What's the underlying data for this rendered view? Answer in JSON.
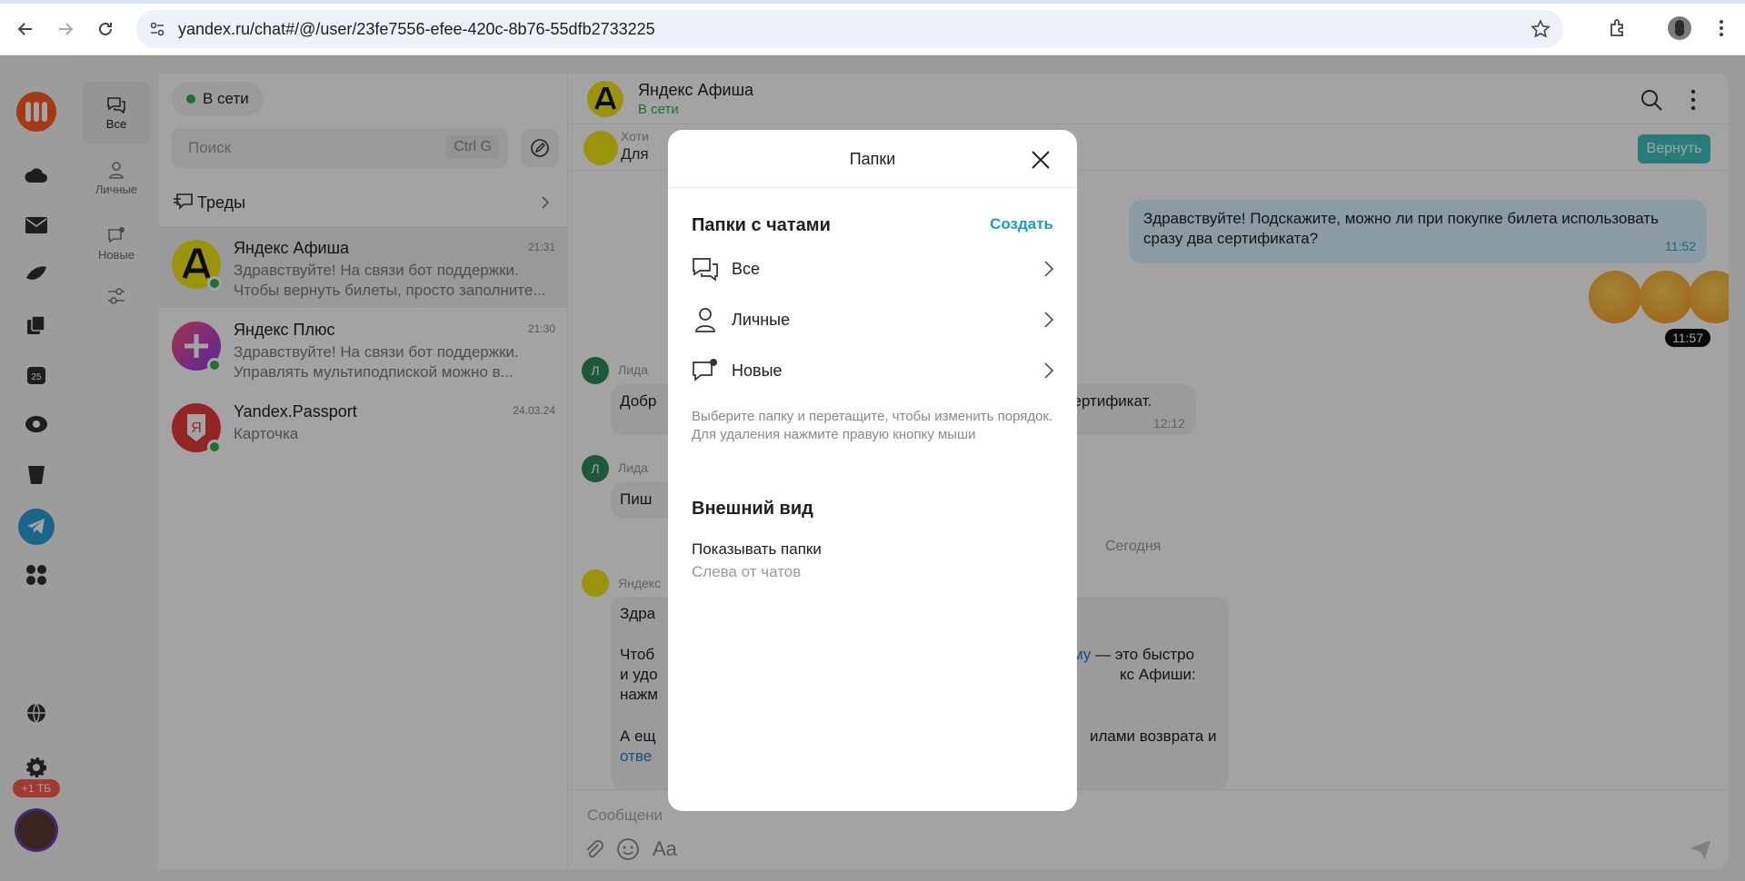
{
  "browser": {
    "url": "yandex.ru/chat#/@/user/23fe7556-efee-420c-8b76-55dfb2733225"
  },
  "rail": {
    "storage_badge": "+1 ТБ"
  },
  "folders": [
    {
      "label": "Все",
      "icon": "chats-icon"
    },
    {
      "label": "Личные",
      "icon": "person-icon"
    },
    {
      "label": "Новые",
      "icon": "new-chat-icon"
    }
  ],
  "chatlist": {
    "status": "В сети",
    "search_placeholder": "Поиск",
    "search_shortcut": "Ctrl G",
    "threads_label": "Треды",
    "chats": [
      {
        "name": "Яндекс Афиша",
        "time": "21:31",
        "preview": "Здравствуйте! На связи бот поддержки. Чтобы вернуть билеты, просто заполните...",
        "avatar_color": "#f4e614"
      },
      {
        "name": "Яндекс Плюс",
        "time": "21:30",
        "preview": "Здравствуйте! На связи бот поддержки. Управлять мультиподпиской можно в...",
        "avatar_color": "#c63cbd"
      },
      {
        "name": "Yandex.Passport",
        "time": "24.03.24",
        "preview": "Карточка",
        "avatar_color": "#e83a3a"
      }
    ]
  },
  "conversation": {
    "title": "Яндекс Афиша",
    "subtitle": "В сети",
    "pinned_sender": "Хоти",
    "pinned_text": "Для",
    "return_button": "Вернуть",
    "out_message": "Здравствуйте! Подскажите, можно ли при покупке билета использовать сразу два сертификата?",
    "out_time": "11:52",
    "emoji_time": "11:57",
    "msg1_sender": "Лида",
    "msg1_avatar": "Л",
    "msg1_text_left": "Добр",
    "msg1_text_right": "сертификат.",
    "msg1_time": "12:12",
    "msg2_sender": "Лида",
    "msg2_avatar": "Л",
    "msg2_text": "Пиш",
    "date_separator": "Сегодня",
    "msg3_sender": "Яндекс",
    "msg3_line1": "Здра",
    "msg3_line2_left": "Чтоб",
    "msg3_line2_right_link": "му",
    "msg3_line2_right": " — это быстро",
    "msg3_line3_left": "и удо",
    "msg3_line3_right": "кс Афиши:",
    "msg3_line4_left": "нажм",
    "msg3_line5_left": "А ещ",
    "msg3_line5_right": "илами возврата и",
    "msg3_line6_link": "отве",
    "composer_placeholder": "Сообщени"
  },
  "modal": {
    "title": "Папки",
    "section_chats": "Папки с чатами",
    "create": "Создать",
    "rows": [
      {
        "label": "Все",
        "icon": "chats-icon"
      },
      {
        "label": "Личные",
        "icon": "person-icon"
      },
      {
        "label": "Новые",
        "icon": "new-chat-icon"
      }
    ],
    "hint": "Выберите папку и перетащите, чтобы изменить порядок. Для удаления нажмите правую кнопку мыши",
    "section_view": "Внешний вид",
    "show_folders_label": "Показывать папки",
    "show_folders_value": "Слева от чатов"
  }
}
